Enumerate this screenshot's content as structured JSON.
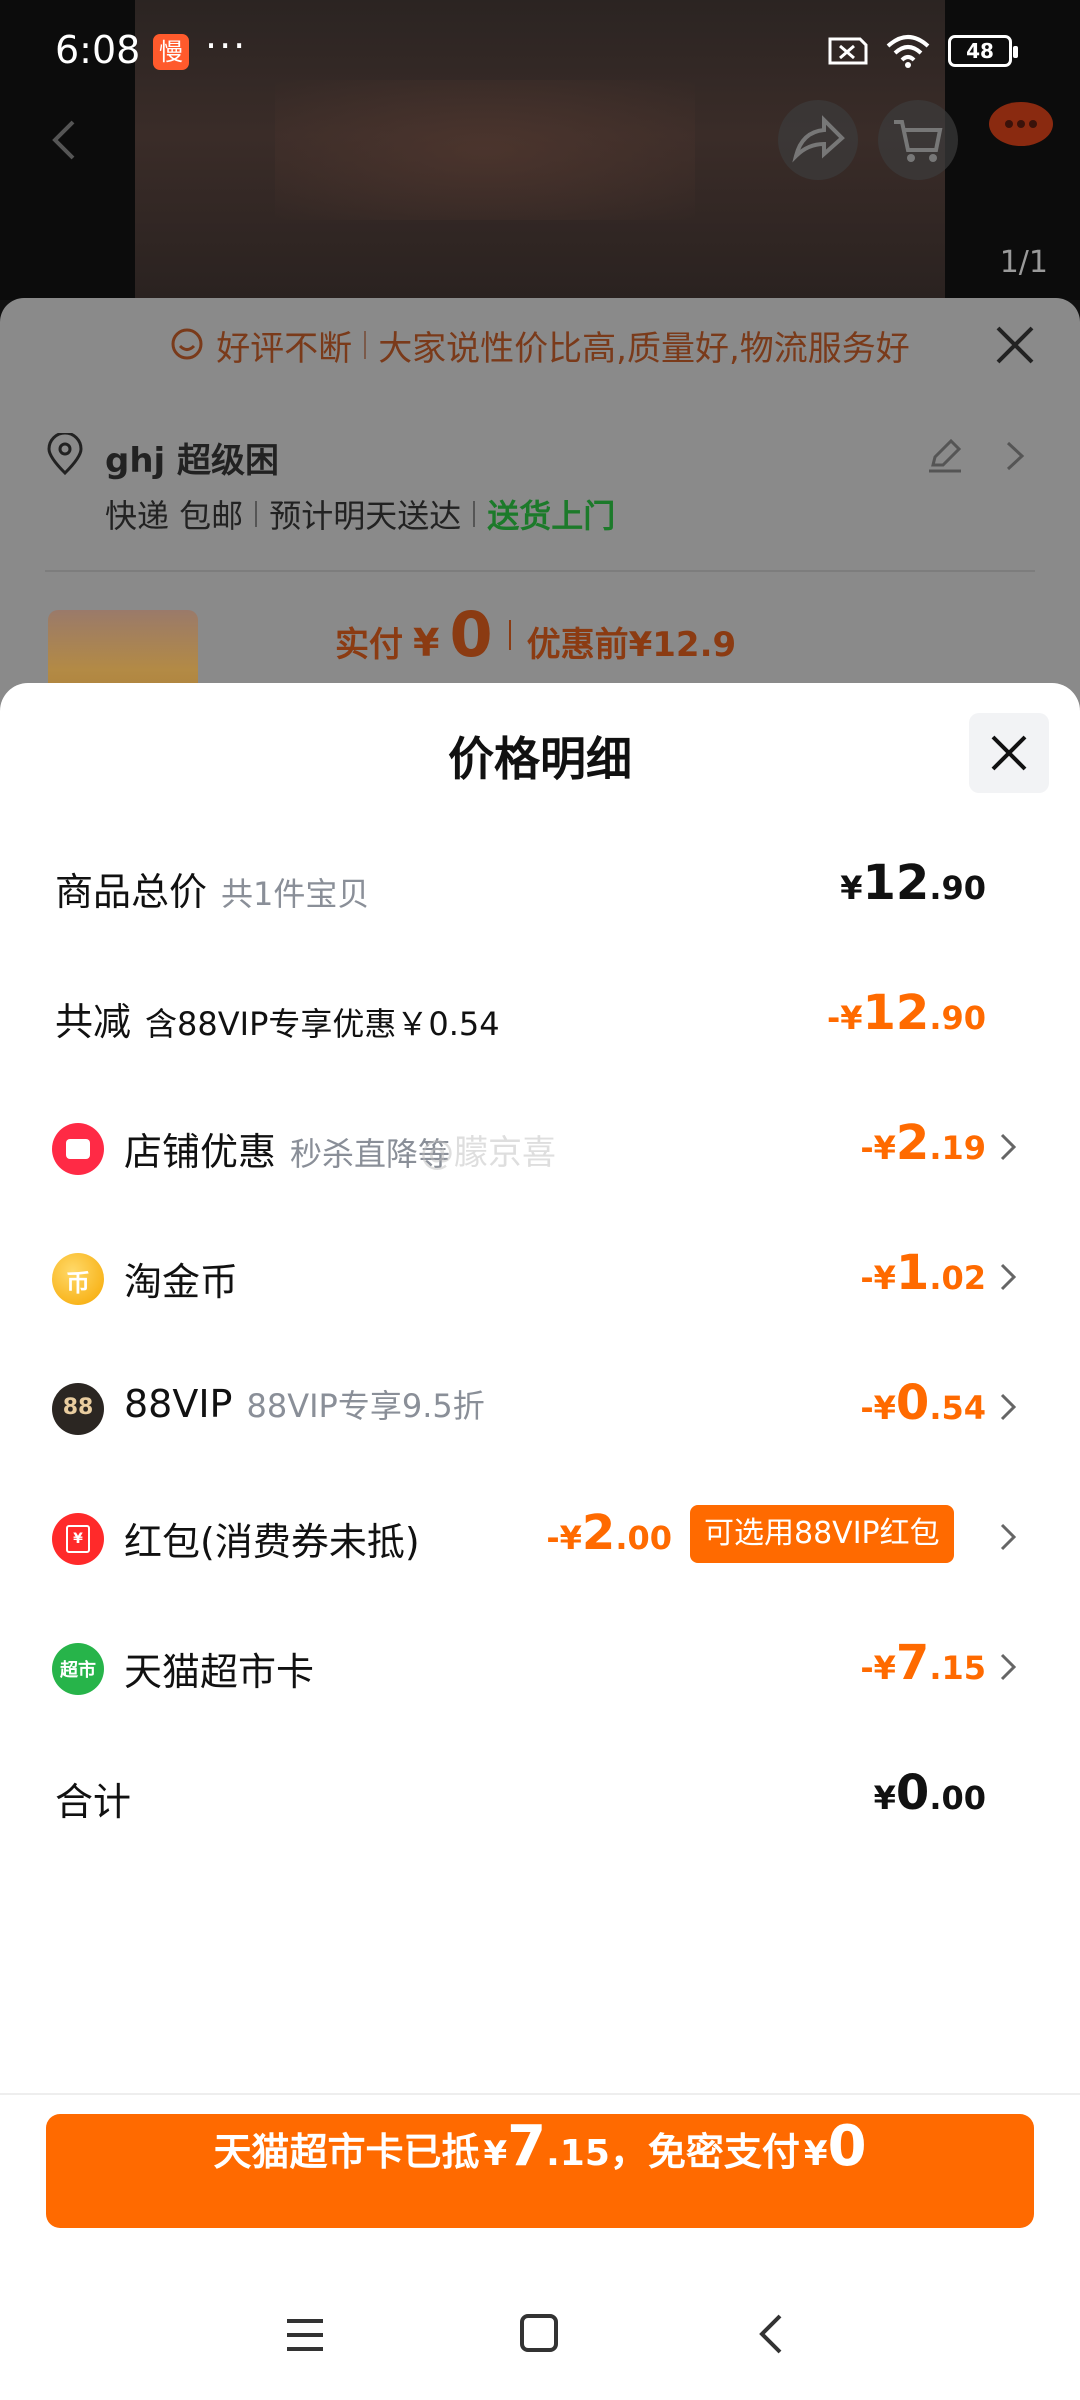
{
  "status_bar": {
    "time": "6:08",
    "app_badge": "慢",
    "dots": "···",
    "battery": "48"
  },
  "product_header": {
    "image_counter": "1/1"
  },
  "banner": {
    "good_review": "好评不断",
    "message": "大家说性价比高,质量好,物流服务好"
  },
  "address": {
    "name": "ghj 超级困",
    "shipping": "快递 包邮",
    "eta": "预计明天送达",
    "delivery": "送货上门"
  },
  "summary": {
    "paid_label": "实付",
    "currency": "¥",
    "paid_value": "0",
    "before_discount": "优惠前¥12.9"
  },
  "sheet": {
    "title": "价格明细",
    "rows": [
      {
        "label": "商品总价",
        "sub": "共1件宝贝",
        "sign": "",
        "currency": "¥",
        "int": "12",
        "dec": ".90"
      },
      {
        "label": "共减",
        "sub": "含88VIP专享优惠￥0.54",
        "sign": "-",
        "currency": "¥",
        "int": "12",
        "dec": ".90"
      },
      {
        "label": "店铺优惠",
        "sub": "秒杀直降等",
        "sign": "-",
        "currency": "¥",
        "int": "2",
        "dec": ".19"
      },
      {
        "label": "淘金币",
        "sub": "",
        "sign": "-",
        "currency": "¥",
        "int": "1",
        "dec": ".02"
      },
      {
        "label": "88VIP",
        "sub": "88VIP专享9.5折",
        "sign": "-",
        "currency": "¥",
        "int": "0",
        "dec": ".54"
      },
      {
        "label": "红包(消费券未抵)",
        "sub": "",
        "sign": "-",
        "currency": "¥",
        "int": "2",
        "dec": ".00",
        "tag": "可选用88VIP红包"
      },
      {
        "label": "天猫超市卡",
        "sub": "",
        "sign": "-",
        "currency": "¥",
        "int": "7",
        "dec": ".15"
      },
      {
        "label": "合计",
        "sub": "",
        "sign": "",
        "currency": "¥",
        "int": "0",
        "dec": ".00"
      }
    ],
    "icons": {
      "coin": "币",
      "vip": "88",
      "market": "超市"
    },
    "watermark": "@朦京喜"
  },
  "pay_button": {
    "text1": "天猫超市卡已抵",
    "currency": "¥",
    "card_int": "7",
    "card_dec": ".15",
    "text2": "，免密支付",
    "pay_int": "0"
  },
  "colors": {
    "accent": "#ff6a00",
    "green": "#1c7a2a",
    "shop_red": "#ff2a45"
  }
}
